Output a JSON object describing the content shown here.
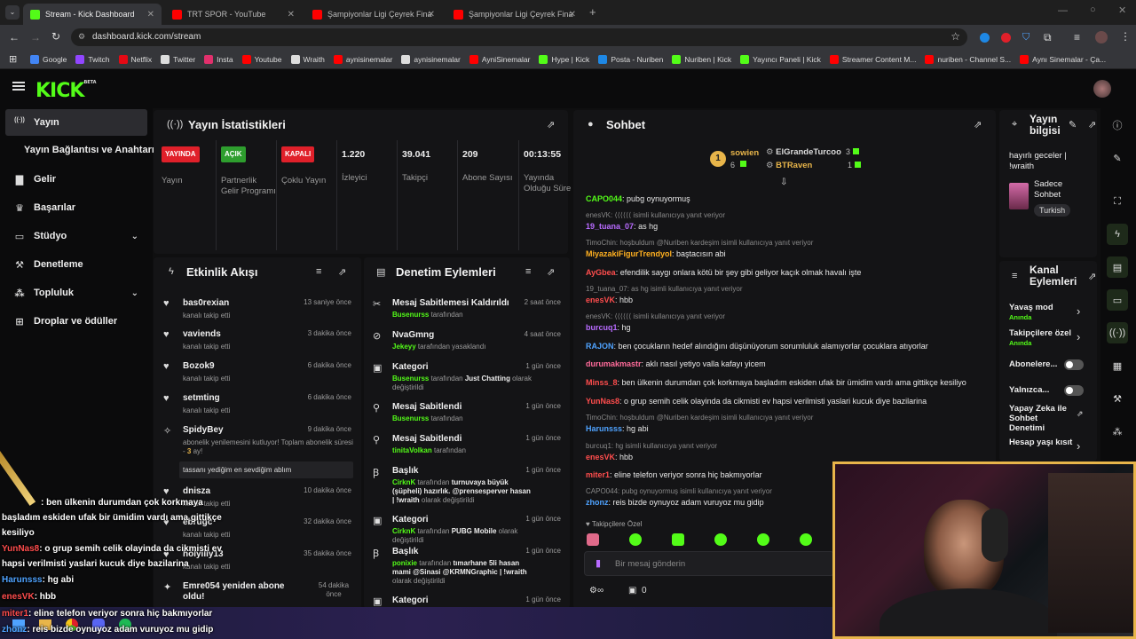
{
  "browser": {
    "tabs": [
      {
        "title": "Stream - Kick Dashboard",
        "active": true,
        "favicon_color": "#53fc18"
      },
      {
        "title": "TRT SPOR - YouTube",
        "active": false,
        "favicon_color": "#ff0000"
      },
      {
        "title": "Şampiyonlar Ligi Çeyrek Final |",
        "active": false,
        "favicon_color": "#ff0000"
      },
      {
        "title": "Şampiyonlar Ligi Çeyrek Final |",
        "active": false,
        "favicon_color": "#ff0000"
      }
    ],
    "url": "dashboard.kick.com/stream",
    "bookmarks": [
      {
        "label": "Google",
        "color": "#4285f4"
      },
      {
        "label": "Twitch",
        "color": "#9146ff"
      },
      {
        "label": "Netflix",
        "color": "#e50914"
      },
      {
        "label": "Twitter",
        "color": "#dddddd"
      },
      {
        "label": "Insta",
        "color": "#e1306c"
      },
      {
        "label": "Youtube",
        "color": "#ff0000"
      },
      {
        "label": "Wraith",
        "color": "#dddddd"
      },
      {
        "label": "aynisinemalar",
        "color": "#ff0000"
      },
      {
        "label": "aynisinemalar",
        "color": "#dddddd"
      },
      {
        "label": "AyniSinemalar",
        "color": "#ff0000"
      },
      {
        "label": "Hype | Kick",
        "color": "#53fc18"
      },
      {
        "label": "Posta - Nuriben",
        "color": "#1e88e5"
      },
      {
        "label": "Nuriben | Kick",
        "color": "#53fc18"
      },
      {
        "label": "Yayıncı Paneli | Kick",
        "color": "#53fc18"
      },
      {
        "label": "Streamer Content M...",
        "color": "#ff0000"
      },
      {
        "label": "nuriben - Channel S...",
        "color": "#ff0000"
      },
      {
        "label": "Aynı Sinemalar - Ça...",
        "color": "#ff0000"
      }
    ]
  },
  "kick": {
    "logo": "KICK",
    "logo_badge": "BETA",
    "brand_color": "#53fc18"
  },
  "sidebar": {
    "items": [
      {
        "label": "Yayın",
        "icon": "broadcast-icon",
        "active": true
      },
      {
        "label": "Yayın Bağlantısı ve Anahtarı",
        "icon": "",
        "active": false
      },
      {
        "label": "Gelir",
        "icon": "chart-icon",
        "active": false
      },
      {
        "label": "Başarılar",
        "icon": "trophy-icon",
        "active": false
      },
      {
        "label": "Stüdyo",
        "icon": "studio-icon",
        "active": false,
        "expand": true
      },
      {
        "label": "Denetleme",
        "icon": "wrench-icon",
        "active": false
      },
      {
        "label": "Topluluk",
        "icon": "community-icon",
        "active": false,
        "expand": true
      },
      {
        "label": "Droplar ve ödüller",
        "icon": "gift-icon",
        "active": false
      }
    ]
  },
  "stats": {
    "title": "Yayın İstatistikleri",
    "columns": [
      {
        "badge": "YAYINDA",
        "badge_color": "#e0202a",
        "label": "Yayın"
      },
      {
        "badge": "AÇIK",
        "badge_color": "#2e9e2e",
        "label": "Partnerlik Gelir Programı"
      },
      {
        "badge": "KAPALI",
        "badge_color": "#e0202a",
        "label": "Çoklu Yayın"
      },
      {
        "value": "1.220",
        "label": "İzleyici"
      },
      {
        "value": "39.041",
        "label": "Takipçi"
      },
      {
        "value": "209",
        "label": "Abone Sayısı"
      },
      {
        "value": "00:13:55",
        "label": "Yayında Olduğu Süre"
      }
    ]
  },
  "activity": {
    "title": "Etkinlik Akışı",
    "items": [
      {
        "name": "bas0rexian",
        "sub": "kanalı takip etti",
        "time": "13 saniye önce"
      },
      {
        "name": "vaviends",
        "sub": "kanalı takip etti",
        "time": "3 dakika önce"
      },
      {
        "name": "Bozok9",
        "sub": "kanalı takip etti",
        "time": "6 dakika önce"
      },
      {
        "name": "setmting",
        "sub": "kanalı takip etti",
        "time": "6 dakika önce"
      },
      {
        "name": "SpidyBey",
        "sub": "abonelik yenilemesini kutluyor! Toplam abonelik süresi - ",
        "sub_highlight": "3",
        "sub_end": " ay!",
        "message": "tassanı yediğim en sevdiğim ablım",
        "time": "9 dakika önce"
      },
      {
        "name": "dnisza",
        "sub": "kanalı takip etti",
        "time": "10 dakika önce"
      },
      {
        "name": "ebrugc",
        "sub": "kanalı takip etti",
        "time": "32 dakika önce"
      },
      {
        "name": "holyilly13",
        "sub": "kanalı takip etti",
        "time": "35 dakika önce"
      },
      {
        "name": "Emre054 yeniden abone oldu!",
        "sub": "",
        "time": "54 dakika önce"
      }
    ]
  },
  "moderation": {
    "title": "Denetim Eylemleri",
    "items": [
      {
        "title": "Mesaj Sabitlemesi Kaldırıldı",
        "actor": "Busenurss",
        "rest": " tarafından",
        "time": "2 saat önce"
      },
      {
        "title": "NvaGmng",
        "actor": "Jekeyy",
        "rest": " tarafından yasaklandı",
        "time": "4 saat önce"
      },
      {
        "title": "Kategori",
        "actor": "Busenurss",
        "rest": " tarafından ",
        "extra": "Just Chatting",
        "rest2": " olarak değiştirildi",
        "time": "1 gün önce"
      },
      {
        "title": "Mesaj Sabitlendi",
        "actor": "Busenurss",
        "rest": " tarafından",
        "time": "1 gün önce"
      },
      {
        "title": "Mesaj Sabitlendi",
        "actor": "tinitaVolkan",
        "rest": " tarafından",
        "time": "1 gün önce"
      },
      {
        "title": "Başlık",
        "actor": "CirknK",
        "rest": " tarafından ",
        "extra": "turnuvaya büyük (şüpheli) hazırlık. @prensesperver hasan | !wraith",
        "rest2": " olarak değiştirildi",
        "time": "1 gün önce"
      },
      {
        "title": "Kategori",
        "actor": "CirknK",
        "rest": " tarafından ",
        "extra": "PUBG Mobile",
        "rest2": " olarak değiştirildi",
        "time": "1 gün önce"
      },
      {
        "title": "Başlık",
        "actor": "ponixie",
        "rest": " tarafından ",
        "extra": "tımarhane 5li hasan mami @Sinasi @KRMNGraphic | !wraith",
        "rest2": " olarak değiştirildi",
        "time": "1 gün önce"
      },
      {
        "title": "Kategori",
        "actor": "",
        "rest": "",
        "time": "1 gün önce"
      }
    ]
  },
  "chat": {
    "title": "Sohbet",
    "leaderboard": [
      {
        "rank": "1",
        "name": "sowien",
        "count": "6"
      },
      {
        "name": "ElGrandeTurcoo",
        "count": "3"
      },
      {
        "name": "BTRaven",
        "count": "1"
      }
    ],
    "messages": [
      {
        "user": "CAPO044",
        "color": "#53fc18",
        "text": "pubg oynuyormuş"
      },
      {
        "reply": "enesVK: ⟨⟨⟨⟨⟨⟨ isimli kullanıcıya yanıt veriyor"
      },
      {
        "user": "19_tuana_07",
        "color": "#b86bff",
        "text": "as hg"
      },
      {
        "reply": "TimoChin: hoşbuldum @Nuriben kardeşim isimli kullanıcıya yanıt veriyor"
      },
      {
        "user": "MiyazakiFigurTrendyol",
        "color": "#ffb020",
        "text": "baştacısın abi"
      },
      {
        "user": "AyGbea",
        "color": "#ff4d4d",
        "text": "efendilik saygı onlara kötü bir şey gibi geliyor kaçık olmak havalı işte"
      },
      {
        "reply": "19_tuana_07: as hg isimli kullanıcıya yanıt veriyor"
      },
      {
        "user": "enesVK",
        "color": "#ff4d4d",
        "text": "hbb"
      },
      {
        "reply": "enesVK: ⟨⟨⟨⟨⟨⟨ isimli kullanıcıya yanıt veriyor"
      },
      {
        "user": "burcuq1",
        "color": "#b86bff",
        "text": "hg"
      },
      {
        "user": "RAJON",
        "color": "#4fa3ff",
        "text": "ben çocukların hedef alındığını düşünüyorum sorumluluk alamıyorlar çocuklara atıyorlar"
      },
      {
        "user": "durumakmastr",
        "color": "#ff6b9a",
        "text": "aklı nasıl yetiyo valla kafayı yicem"
      },
      {
        "user": "Minss_8",
        "color": "#ff4d4d",
        "text": "ben ülkenin durumdan çok korkmaya başladım eskiden ufak bir ümidim vardı ama gittikçe kesiliyo"
      },
      {
        "user": "YunNas8",
        "color": "#ff4d4d",
        "text": "o grup semih celik olayinda da cikmisti ev hapsi verilmisti yaslari kucuk diye bazilarina"
      },
      {
        "reply": "TimoChin: hoşbuldum @Nuriben kardeşim isimli kullanıcıya yanıt veriyor"
      },
      {
        "user": "Harunsss",
        "color": "#4fa3ff",
        "text": "hg abi"
      },
      {
        "reply": "burcuq1: hg isimli kullanıcıya yanıt veriyor"
      },
      {
        "user": "enesVK",
        "color": "#ff4d4d",
        "text": "hbb"
      },
      {
        "user": "miter1",
        "color": "#ff4d4d",
        "text": "eline telefon veriyor sonra hiç bakmıyorlar"
      },
      {
        "reply": "CAPO044: pubg oynuyormuş isimli kullanıcıya yanıt veriyor"
      },
      {
        "user": "zhonz",
        "color": "#4fa3ff",
        "text": "reis bizde oynuyoz adam vuruyoz mu gidip"
      }
    ],
    "followers_only": "Takipçilere Özel",
    "input_placeholder": "Bir mesaj gönderin",
    "gift_count": "0"
  },
  "stream_info": {
    "title": "Yayın bilgisi",
    "stream_title": "hayırlı geceler | !wraith",
    "category": "Sadece Sohbet",
    "language": "Turkish"
  },
  "channel_actions": {
    "title": "Kanal Eylemleri",
    "items": [
      {
        "label": "Yavaş mod",
        "sub": "Anında",
        "type": "arrow"
      },
      {
        "label": "Takipçilere özel",
        "sub": "Anında",
        "type": "arrow"
      },
      {
        "label": "Abonelere...",
        "type": "toggle"
      },
      {
        "label": "Yalnızca...",
        "type": "toggle"
      },
      {
        "label": "Yapay Zeka ile Sohbet Denetimi",
        "type": "link"
      },
      {
        "label": "Hesap yaşı kısıt",
        "type": "arrow"
      }
    ]
  },
  "overlay_chat": [
    {
      "user": "",
      "color": "#ff4d4d",
      "text": ": ben ülkenin durumdan çok korkmaya"
    },
    {
      "user": "",
      "color": "#ff4d4d",
      "text": "başladım eskiden ufak bir ümidim vardı ama gittikçe"
    },
    {
      "user": "",
      "color": "#ff4d4d",
      "text": "kesiliyo"
    },
    {
      "user": "YunNas8",
      "color": "#ff4d4d",
      "text": ": o grup semih celik olayinda da cikmisti ev"
    },
    {
      "user": "",
      "color": "#ff4d4d",
      "text": "hapsi verilmisti yaslari kucuk diye bazilarina"
    },
    {
      "user": "Harunsss",
      "color": "#4fa3ff",
      "text": ": hg abi"
    },
    {
      "user": "enesVK",
      "color": "#ff4d4d",
      "text": ": hbb"
    },
    {
      "user": "miter1",
      "color": "#ff4d4d",
      "text": ": eline telefon veriyor sonra hiç bakmıyorlar"
    },
    {
      "user": "zhonz",
      "color": "#4fa3ff",
      "text": ": reis bizde oynuyoz adam vuruyoz mu gidip"
    }
  ]
}
